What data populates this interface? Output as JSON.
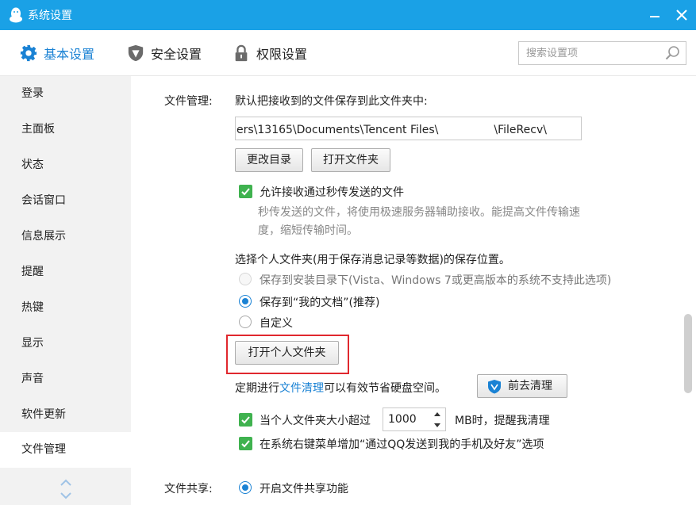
{
  "window": {
    "title": "系统设置",
    "accent_color": "#1aa1e6"
  },
  "tabs": [
    {
      "label": "基本设置",
      "icon": "gear-icon",
      "active": true
    },
    {
      "label": "安全设置",
      "icon": "shield-icon",
      "active": false
    },
    {
      "label": "权限设置",
      "icon": "lock-icon",
      "active": false
    }
  ],
  "search": {
    "placeholder": "搜索设置项"
  },
  "sidebar": {
    "items": [
      {
        "label": "登录"
      },
      {
        "label": "主面板"
      },
      {
        "label": "状态"
      },
      {
        "label": "会话窗口"
      },
      {
        "label": "信息展示"
      },
      {
        "label": "提醒"
      },
      {
        "label": "热键"
      },
      {
        "label": "显示"
      },
      {
        "label": "声音"
      },
      {
        "label": "软件更新"
      },
      {
        "label": "文件管理"
      }
    ],
    "active_index": 10
  },
  "file_management": {
    "section_label": "文件管理:",
    "save_desc": "默认把接收到的文件保存到此文件夹中:",
    "path_value": "ers\\13165\\Documents\\Tencent Files\\　　　　　\\FileRecv\\",
    "change_dir_button": "更改目录",
    "open_folder_button": "打开文件夹",
    "allow_fast_transfer": {
      "label": "允许接收通过秒传发送的文件",
      "checked": true,
      "desc_line1": "秒传发送的文件，将使用极速服务器辅助接收。能提高文件传输速",
      "desc_line2": "度，缩短传输时间。"
    },
    "personal_folder_prompt": "选择个人文件夹(用于保存消息记录等数据)的保存位置。",
    "radio_options": [
      {
        "label": "保存到安装目录下(Vista、Windows 7或更高版本的系统不支持此选项)",
        "checked": false,
        "disabled": true
      },
      {
        "label": "保存到“我的文档”(推荐)",
        "checked": true,
        "disabled": false
      },
      {
        "label": "自定义",
        "checked": false,
        "disabled": false
      }
    ],
    "open_personal_folder_button": "打开个人文件夹",
    "cleanup_prefix": "定期进行",
    "cleanup_link": "文件清理",
    "cleanup_suffix": "可以有效节省硬盘空间。",
    "go_cleanup_button": "前去清理",
    "size_limit": {
      "prefix": "当个人文件夹大小超过",
      "value": "1000",
      "suffix": "MB时，提醒我清理",
      "checked": true
    },
    "context_menu": {
      "label": "在系统右键菜单增加“通过QQ发送到我的手机及好友”选项",
      "checked": true
    }
  },
  "file_sharing": {
    "section_label": "文件共享:",
    "enable_label": "开启文件共享功能",
    "checked": true
  },
  "highlight_color": "#e0282e"
}
